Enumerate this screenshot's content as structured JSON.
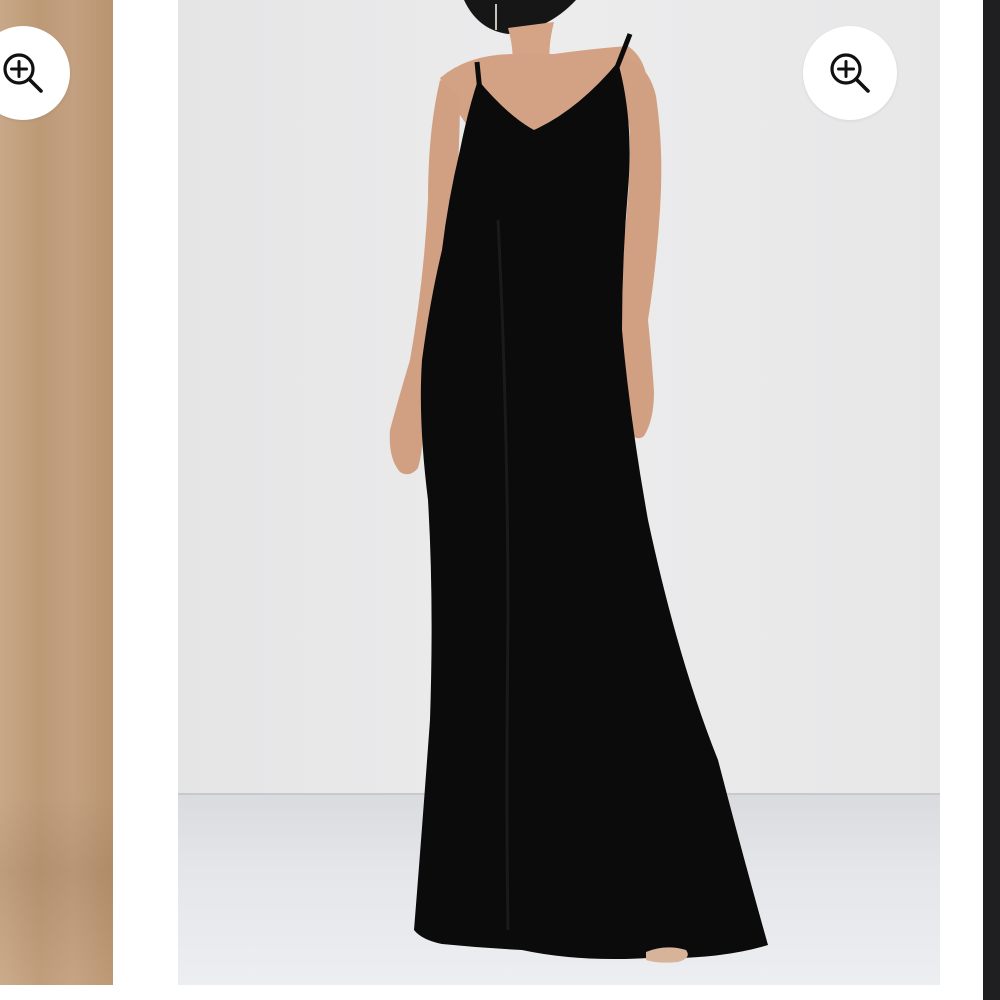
{
  "gallery": {
    "background_color": "#ffffff",
    "slides": [
      {
        "name": "slide-previous",
        "image_color": "#c3a080"
      },
      {
        "name": "slide-current",
        "image": "black-maxi-dress-photo",
        "image_color": "#0b0b0c"
      },
      {
        "name": "slide-next",
        "image_color": "#1f1f21"
      }
    ],
    "zoom_icon": "zoom-in-icon"
  }
}
